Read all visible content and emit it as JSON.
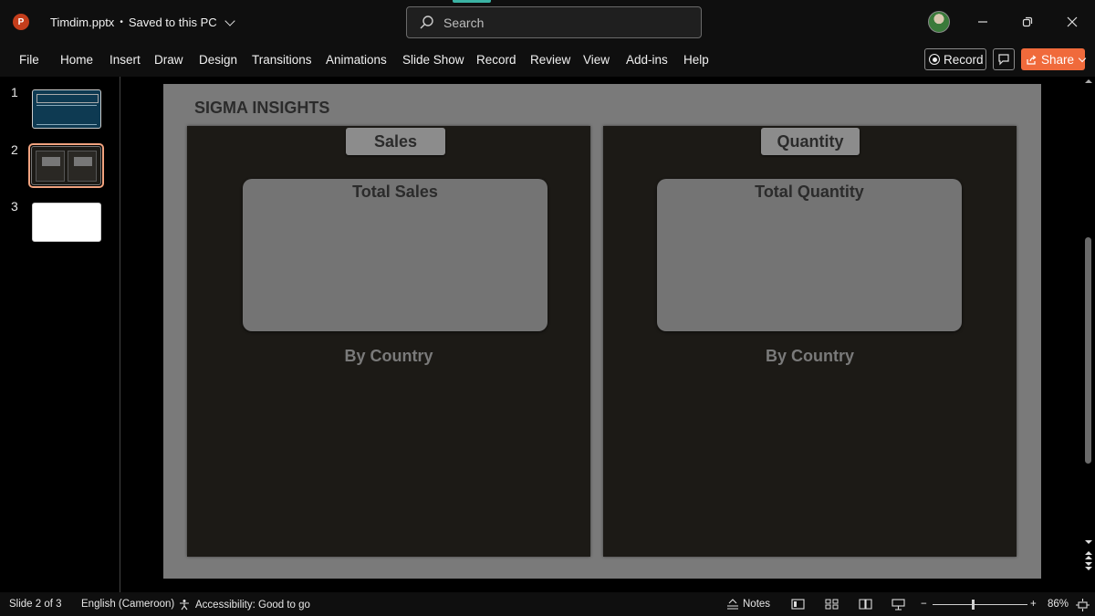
{
  "app": {
    "logo_letter": "P"
  },
  "titlebar": {
    "filename": "Timdim.pptx",
    "separator": "•",
    "save_status": "Saved to this PC",
    "search_placeholder": "Search"
  },
  "ribbon": {
    "tabs": [
      "File",
      "Home",
      "Insert",
      "Draw",
      "Design",
      "Transitions",
      "Animations",
      "Slide Show",
      "Record",
      "Review",
      "View",
      "Add-ins",
      "Help"
    ],
    "record_label": "Record",
    "share_label": "Share"
  },
  "thumbnails": {
    "numbers": [
      "1",
      "2",
      "3"
    ]
  },
  "slide": {
    "title": "SIGMA INSIGHTS",
    "left": {
      "pill": "Sales",
      "card_title": "Total Sales",
      "subheading": "By Country"
    },
    "right": {
      "pill": "Quantity",
      "card_title": "Total Quantity",
      "subheading": "By Country"
    }
  },
  "statusbar": {
    "slide_counter": "Slide 2 of 3",
    "language": "English (Cameroon)",
    "accessibility": "Accessibility: Good to go",
    "notes_label": "Notes",
    "zoom_minus": "−",
    "zoom_plus": "+",
    "zoom_level": "86%"
  },
  "colors": {
    "share": "#f06a3b",
    "selected_thumb_border": "#f1a37f",
    "panel_bg": "#1c1a16",
    "slide_bg": "#7a7a7a"
  }
}
